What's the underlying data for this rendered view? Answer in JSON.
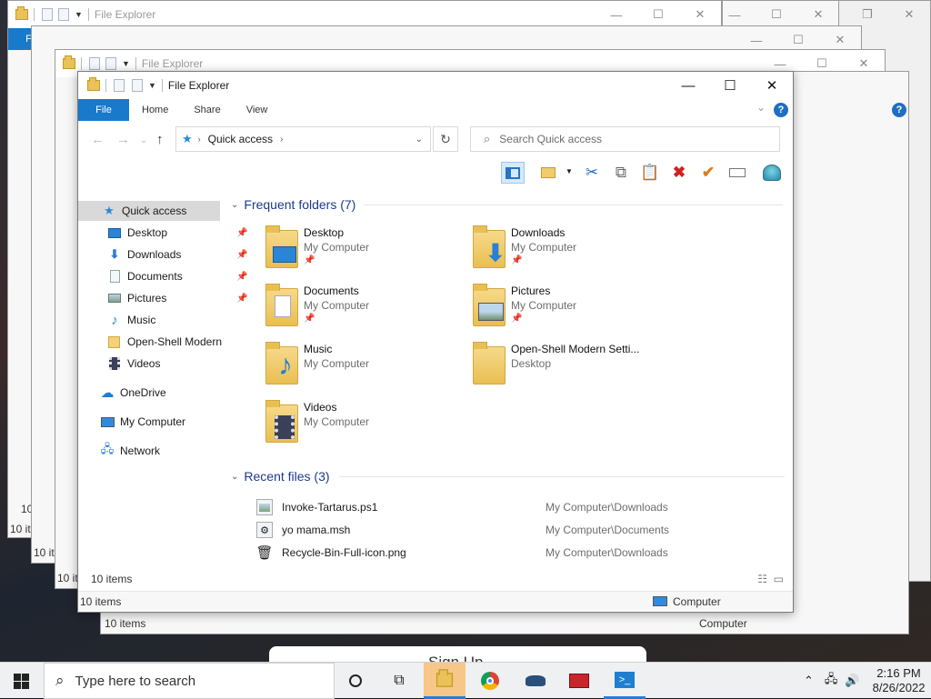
{
  "app": {
    "title": "File Explorer"
  },
  "ribbon": {
    "file": "File",
    "home": "Home",
    "share": "Share",
    "view": "View",
    "help": "?"
  },
  "address": {
    "location": "Quick access",
    "search_placeholder": "Search Quick access"
  },
  "nav": {
    "quick_access": "Quick access",
    "items": [
      {
        "label": "Desktop",
        "icon": "desktop-icon",
        "pinned": true
      },
      {
        "label": "Downloads",
        "icon": "downloads-icon",
        "pinned": true
      },
      {
        "label": "Documents",
        "icon": "documents-icon",
        "pinned": true
      },
      {
        "label": "Pictures",
        "icon": "pictures-icon",
        "pinned": true
      },
      {
        "label": "Music",
        "icon": "music-icon",
        "pinned": false
      },
      {
        "label": "Open-Shell Modern",
        "icon": "folder-icon",
        "pinned": false
      },
      {
        "label": "Videos",
        "icon": "videos-icon",
        "pinned": false
      }
    ],
    "onedrive": "OneDrive",
    "my_computer": "My Computer",
    "network": "Network"
  },
  "frequent": {
    "header": "Frequent folders (7)",
    "folders": [
      {
        "name": "Desktop",
        "location": "My Computer",
        "pinned": true
      },
      {
        "name": "Downloads",
        "location": "My Computer",
        "pinned": true
      },
      {
        "name": "Documents",
        "location": "My Computer",
        "pinned": true
      },
      {
        "name": "Pictures",
        "location": "My Computer",
        "pinned": true
      },
      {
        "name": "Music",
        "location": "My Computer",
        "pinned": false
      },
      {
        "name": "Open-Shell Modern Setti...",
        "location": "Desktop",
        "pinned": false
      },
      {
        "name": "Videos",
        "location": "My Computer",
        "pinned": false
      }
    ]
  },
  "recent": {
    "header": "Recent files (3)",
    "files": [
      {
        "name": "Invoke-Tartarus.ps1",
        "path": "My Computer\\Downloads"
      },
      {
        "name": "yo mama.msh",
        "path": "My Computer\\Documents"
      },
      {
        "name": "Recycle-Bin-Full-icon.png",
        "path": "My Computer\\Downloads"
      }
    ]
  },
  "status": {
    "items": "10 items",
    "location": "Computer"
  },
  "background": {
    "card_text": "Sign Up"
  },
  "taskbar": {
    "search_placeholder": "Type here to search",
    "time": "2:16 PM",
    "date": "8/26/2022"
  },
  "colors": {
    "accent": "#1979ca",
    "group_header": "#1e3a8a",
    "folder": "#e9bf52",
    "delete_red": "#d11f1f",
    "check_orange": "#e07b1a"
  }
}
